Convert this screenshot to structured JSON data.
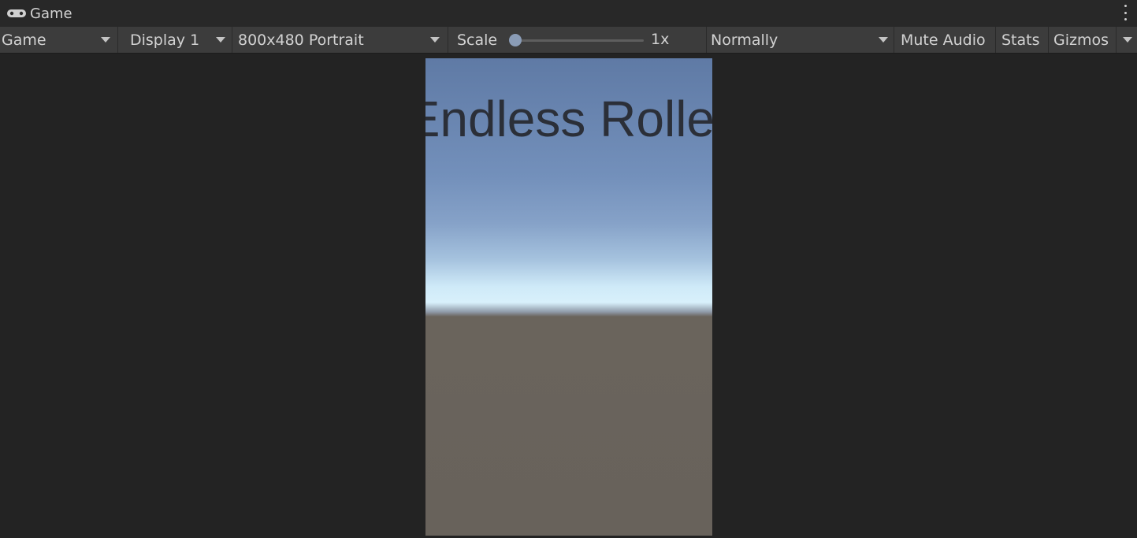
{
  "window": {
    "tab_title": "Game",
    "tab_icon": "gamepad-icon",
    "menu_icon": "kebab-menu-icon"
  },
  "toolbar": {
    "view_mode": "Game",
    "display": "Display 1",
    "resolution": "800x480 Portrait",
    "scale_label": "Scale",
    "scale_value": "1x",
    "scale_fraction": 0.0,
    "play_mode": "Normally",
    "mute_audio": "Mute Audio",
    "stats": "Stats",
    "gizmos": "Gizmos"
  },
  "game_view": {
    "title_text": "Endless Roller",
    "sky_top_color": "#5f7aa5",
    "horizon_color": "#d8f0fb",
    "ground_color": "#68625b"
  }
}
